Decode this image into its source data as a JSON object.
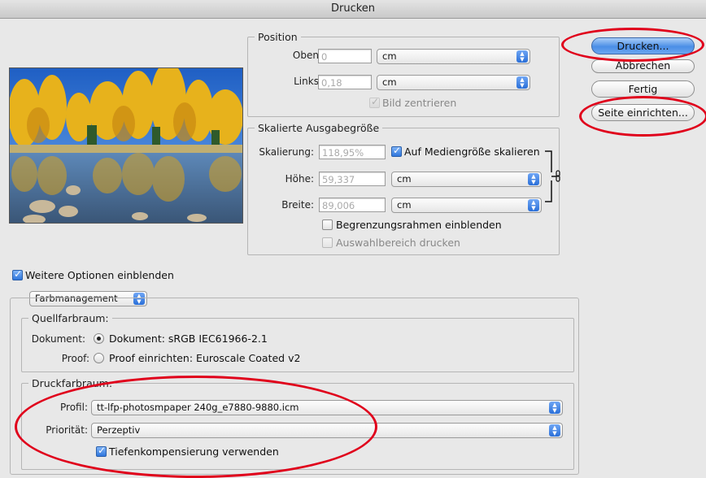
{
  "window": {
    "title": "Drucken"
  },
  "colors": {
    "accent": "#3f86e8",
    "annotation": "#e0001b"
  },
  "position": {
    "legend": "Position",
    "top_label": "Oben:",
    "top_value": "0",
    "top_unit": "cm",
    "left_label": "Links:",
    "left_value": "0,18",
    "left_unit": "cm",
    "center_label": "Bild zentrieren",
    "center_checked": true
  },
  "scaled": {
    "legend": "Skalierte Ausgabegröße",
    "scale_label": "Skalierung:",
    "scale_value": "118,95%",
    "fit_media_label": "Auf Mediengröße skalieren",
    "fit_media_checked": true,
    "height_label": "Höhe:",
    "height_value": "59,337",
    "height_unit": "cm",
    "width_label": "Breite:",
    "width_value": "89,006",
    "width_unit": "cm",
    "bbox_label": "Begrenzungsrahmen einblenden",
    "bbox_checked": false,
    "selection_label": "Auswahlbereich drucken",
    "selection_checked": false
  },
  "buttons": {
    "print": "Drucken...",
    "cancel": "Abbrechen",
    "done": "Fertig",
    "page_setup": "Seite einrichten..."
  },
  "more_options": {
    "label": "Weitere Optionen einblenden",
    "checked": true
  },
  "color_management": {
    "menu_value": "Farbmanagement",
    "source_legend": "Quellfarbraum:",
    "document_label": "Dokument:",
    "document_option": "Dokument: sRGB IEC61966-2.1",
    "document_selected": true,
    "proof_label": "Proof:",
    "proof_option": "Proof einrichten: Euroscale Coated v2",
    "proof_selected": false,
    "print_legend": "Druckfarbraum:",
    "profile_label": "Profil:",
    "profile_value": "tt-lfp-photosmpaper 240g_e7880-9880.icm",
    "intent_label": "Priorität:",
    "intent_value": "Perzeptiv",
    "bpc_label": "Tiefenkompensierung verwenden",
    "bpc_checked": true
  },
  "icons": {
    "popup": "up-down-arrows-icon",
    "chain": "chain-link-icon",
    "preview": "autumn-lake-photo"
  }
}
